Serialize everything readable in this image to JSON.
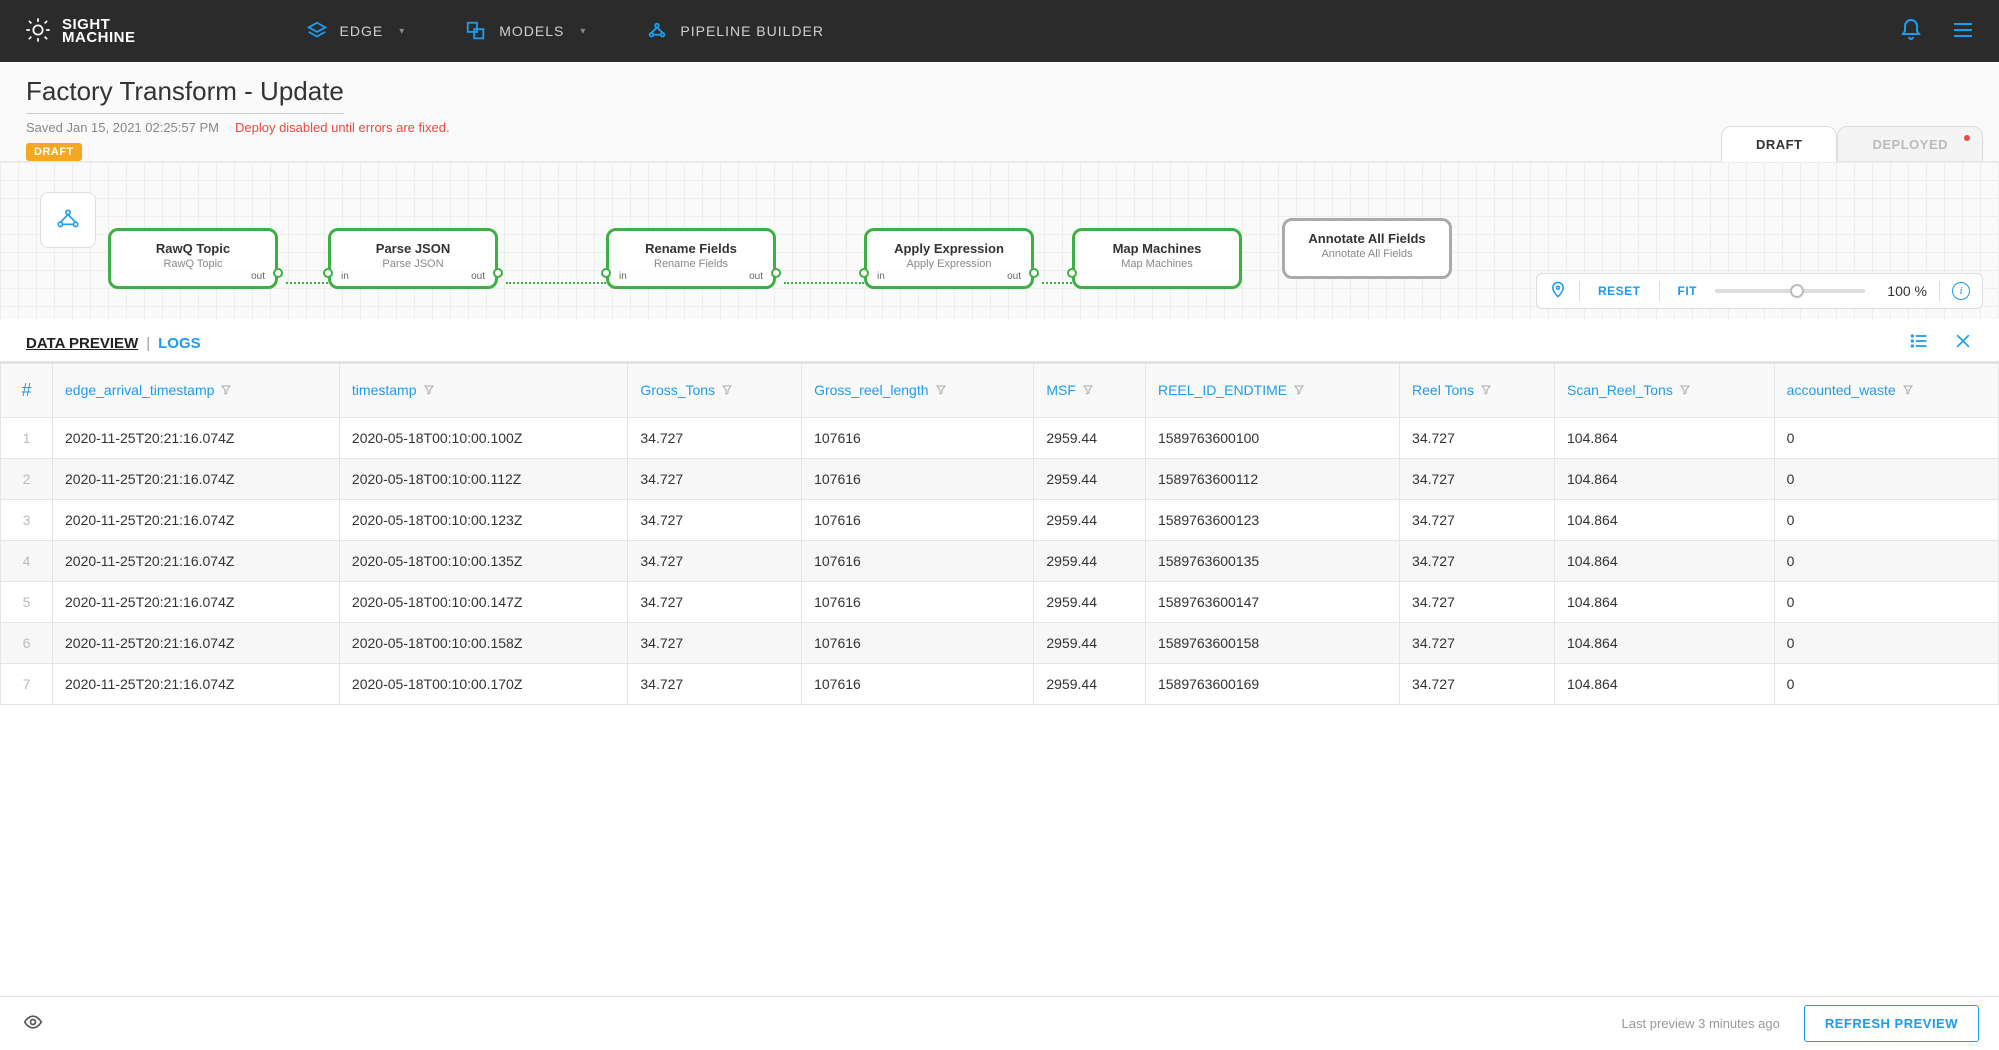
{
  "brand": {
    "name_line1": "SIGHT",
    "name_line2": "MACHINE"
  },
  "nav": {
    "edge": "EDGE",
    "models": "MODELS",
    "pipeline": "PIPELINE BUILDER"
  },
  "header": {
    "title": "Factory Transform - Update",
    "saved": "Saved Jan 15, 2021 02:25:57 PM",
    "error": "Deploy disabled until errors are fixed.",
    "draft_badge": "DRAFT"
  },
  "version_tabs": {
    "draft": "DRAFT",
    "deployed": "DEPLOYED"
  },
  "canvas": {
    "nodes": [
      {
        "title": "RawQ Topic",
        "sub": "RawQ Topic"
      },
      {
        "title": "Parse JSON",
        "sub": "Parse JSON"
      },
      {
        "title": "Rename Fields",
        "sub": "Rename Fields"
      },
      {
        "title": "Apply Expression",
        "sub": "Apply Expression"
      },
      {
        "title": "Map Machines",
        "sub": "Map Machines"
      },
      {
        "title": "Annotate All Fields",
        "sub": "Annotate All Fields"
      }
    ],
    "port_in": "in",
    "port_out": "out",
    "controls": {
      "reset": "RESET",
      "fit": "FIT",
      "zoom": "100 %"
    }
  },
  "subtabs": {
    "data_preview": "DATA PREVIEW",
    "logs": "LOGS"
  },
  "table": {
    "columns": [
      "edge_arrival_timestamp",
      "timestamp",
      "Gross_Tons",
      "Gross_reel_length",
      "MSF",
      "REEL_ID_ENDTIME",
      "Reel Tons",
      "Scan_Reel_Tons",
      "accounted_waste"
    ],
    "rows": [
      [
        "2020-11-25T20:21:16.074Z",
        "2020-05-18T00:10:00.100Z",
        "34.727",
        "107616",
        "2959.44",
        "1589763600100",
        "34.727",
        "104.864",
        "0"
      ],
      [
        "2020-11-25T20:21:16.074Z",
        "2020-05-18T00:10:00.112Z",
        "34.727",
        "107616",
        "2959.44",
        "1589763600112",
        "34.727",
        "104.864",
        "0"
      ],
      [
        "2020-11-25T20:21:16.074Z",
        "2020-05-18T00:10:00.123Z",
        "34.727",
        "107616",
        "2959.44",
        "1589763600123",
        "34.727",
        "104.864",
        "0"
      ],
      [
        "2020-11-25T20:21:16.074Z",
        "2020-05-18T00:10:00.135Z",
        "34.727",
        "107616",
        "2959.44",
        "1589763600135",
        "34.727",
        "104.864",
        "0"
      ],
      [
        "2020-11-25T20:21:16.074Z",
        "2020-05-18T00:10:00.147Z",
        "34.727",
        "107616",
        "2959.44",
        "1589763600147",
        "34.727",
        "104.864",
        "0"
      ],
      [
        "2020-11-25T20:21:16.074Z",
        "2020-05-18T00:10:00.158Z",
        "34.727",
        "107616",
        "2959.44",
        "1589763600158",
        "34.727",
        "104.864",
        "0"
      ],
      [
        "2020-11-25T20:21:16.074Z",
        "2020-05-18T00:10:00.170Z",
        "34.727",
        "107616",
        "2959.44",
        "1589763600169",
        "34.727",
        "104.864",
        "0"
      ]
    ]
  },
  "footer": {
    "last_preview": "Last preview 3 minutes ago",
    "refresh": "REFRESH PREVIEW"
  }
}
